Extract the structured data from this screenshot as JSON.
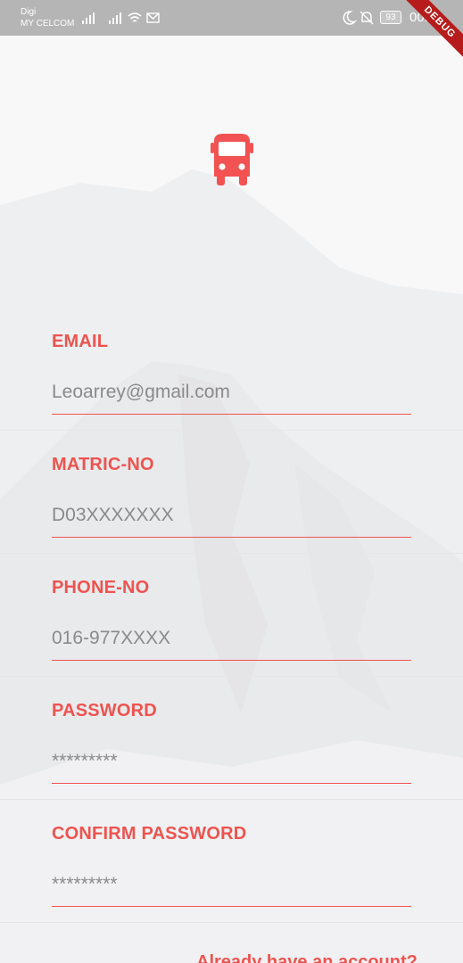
{
  "status_bar": {
    "carrier_line1": "Digi",
    "carrier_line2": "MY CELCOM",
    "battery": "93",
    "time": "00:59"
  },
  "debug_banner": "DEBUG",
  "logo": {
    "icon": "bus-icon",
    "color": "#f25252"
  },
  "form": {
    "email": {
      "label": "EMAIL",
      "placeholder": "Leoarrey@gmail.com"
    },
    "matric": {
      "label": "MATRIC-NO",
      "placeholder": "D03XXXXXXX"
    },
    "phone": {
      "label": "PHONE-NO",
      "placeholder": "016-977XXXX"
    },
    "password": {
      "label": "PASSWORD",
      "placeholder": "*********"
    },
    "confirm_password": {
      "label": "CONFIRM PASSWORD",
      "placeholder": "*********"
    }
  },
  "footer": {
    "link_text": "Already have an account?"
  },
  "colors": {
    "accent": "#ef5350",
    "status_bar": "#b5b5b5",
    "background": "#f8f8f9"
  }
}
